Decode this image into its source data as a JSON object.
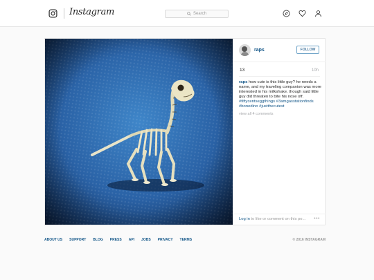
{
  "header": {
    "logo_text": "Instagram",
    "search_placeholder": "Search",
    "nav_icons": [
      "compass-icon",
      "heart-icon",
      "person-icon"
    ]
  },
  "post": {
    "username": "raps",
    "follow_label": "FOLLOW",
    "likes": "13",
    "time": "10h",
    "caption_user": "raps",
    "caption_text": "how cute is this little guy? he needs a name, and my traveling companion was more interested in his milkshake. though said little guy did threaten to bite his nose off.",
    "hashtags": [
      "#fiftycentseggthings",
      "#3amgasstationfinds",
      "#bonedino",
      "#justthecutest"
    ],
    "view_all": "view all 4 comments",
    "login_link": "Log in",
    "login_rest": "to like or comment on this po...",
    "more_label": "•••"
  },
  "footer": {
    "links": [
      "ABOUT US",
      "SUPPORT",
      "BLOG",
      "PRESS",
      "API",
      "JOBS",
      "PRIVACY",
      "TERMS"
    ],
    "copyright": "© 2016 INSTAGRAM"
  },
  "colors": {
    "link_blue": "#125688",
    "follow_blue": "#3f729b",
    "border": "#e6e6e6",
    "photo_blue": "#2f6fb3"
  }
}
